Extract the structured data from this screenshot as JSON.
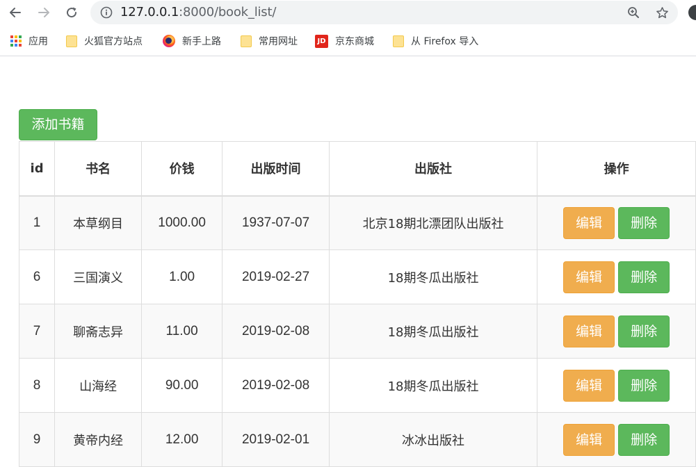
{
  "browser": {
    "url_host": "127.0.0.1",
    "url_rest": ":8000/book_list/"
  },
  "bookmarks": [
    {
      "label": "应用",
      "icon": "apps-icon"
    },
    {
      "label": "火狐官方站点",
      "icon": "folder-icon"
    },
    {
      "label": "新手上路",
      "icon": "firefox-icon"
    },
    {
      "label": "常用网址",
      "icon": "folder-icon"
    },
    {
      "label": "京东商城",
      "icon": "jd-icon",
      "icon_text": "JD"
    },
    {
      "label": "从 Firefox 导入",
      "icon": "folder-icon"
    }
  ],
  "page": {
    "add_button_label": "添加书籍"
  },
  "table": {
    "headers": [
      "id",
      "书名",
      "价钱",
      "出版时间",
      "出版社",
      "操作"
    ],
    "edit_label": "编辑",
    "delete_label": "删除",
    "rows": [
      {
        "id": "1",
        "title": "本草纲目",
        "price": "1000.00",
        "date": "1937-07-07",
        "publisher": "北京18期北漂团队出版社"
      },
      {
        "id": "6",
        "title": "三国演义",
        "price": "1.00",
        "date": "2019-02-27",
        "publisher": "18期冬瓜出版社"
      },
      {
        "id": "7",
        "title": "聊斋志异",
        "price": "11.00",
        "date": "2019-02-08",
        "publisher": "18期冬瓜出版社"
      },
      {
        "id": "8",
        "title": "山海经",
        "price": "90.00",
        "date": "2019-02-08",
        "publisher": "18期冬瓜出版社"
      },
      {
        "id": "9",
        "title": "黄帝内经",
        "price": "12.00",
        "date": "2019-02-01",
        "publisher": "冰冰出版社"
      }
    ]
  },
  "colors": {
    "success": "#5cb85c",
    "warning": "#f0ad4e",
    "border": "#dddddd"
  }
}
